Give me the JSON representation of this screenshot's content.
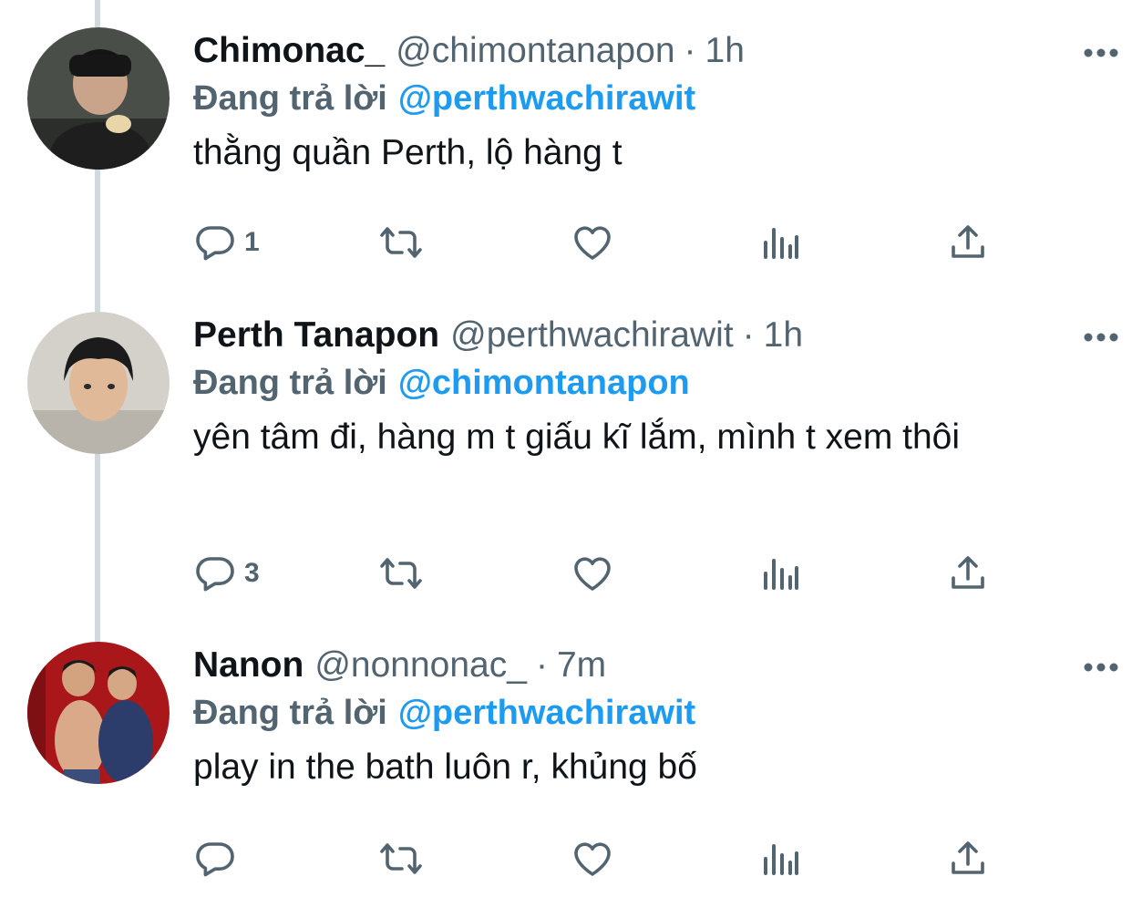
{
  "tweets": [
    {
      "display_name": "Chimonac_",
      "handle": "@chimontanapon",
      "dot": "·",
      "time": "1h",
      "reply_label": "Đang trả lời",
      "reply_to": "@perthwachirawit",
      "text": "thằng quần Perth, lộ hàng t",
      "reply_count": "1",
      "avatar_bg": "#3a3f3a"
    },
    {
      "display_name": "Perth Tanapon",
      "handle": "@perthwachirawit",
      "dot": "·",
      "time": "1h",
      "reply_label": "Đang trả lời",
      "reply_to": "@chimontanapon",
      "text": "yên tâm đi, hàng m t giấu kĩ lắm, mình t xem thôi",
      "reply_count": "3",
      "avatar_bg": "#c9c6bf"
    },
    {
      "display_name": "Nanon",
      "handle": "@nonnonac_",
      "dot": "·",
      "time": "7m",
      "reply_label": "Đang trả lời",
      "reply_to": "@perthwachirawit",
      "text": "play in the bath luôn r, khủng bố",
      "reply_count": "",
      "avatar_bg": "#b11a1a"
    }
  ],
  "icons": {
    "reply": "reply-icon",
    "retweet": "retweet-icon",
    "like": "heart-icon",
    "views": "analytics-icon",
    "share": "share-icon",
    "more": "more-icon"
  },
  "colors": {
    "text": "#0f1419",
    "muted": "#536471",
    "link": "#1d9bf0",
    "thread_line": "#cfd9de"
  }
}
